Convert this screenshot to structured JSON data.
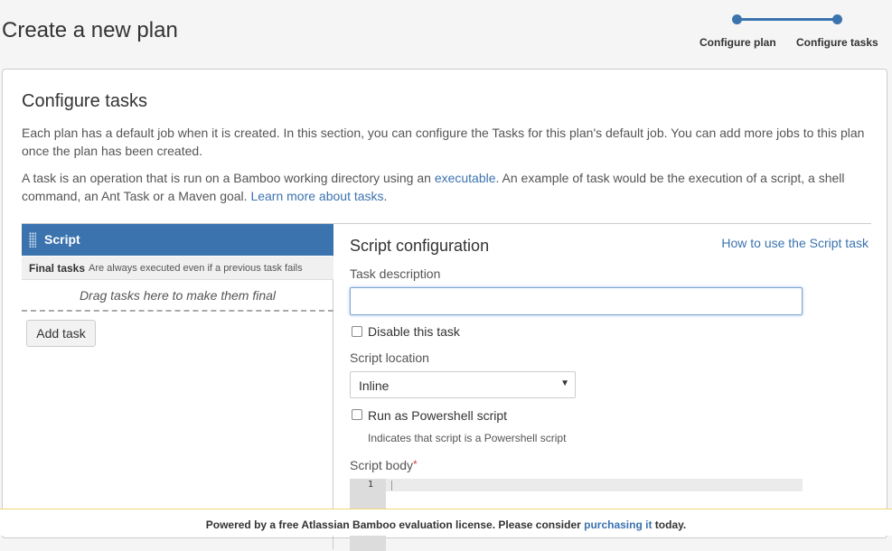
{
  "header": {
    "title": "Create a new plan",
    "steps": [
      {
        "label": "Configure plan",
        "completed": true
      },
      {
        "label": "Configure tasks",
        "current": true
      }
    ]
  },
  "panel": {
    "title": "Configure tasks",
    "intro_1": "Each plan has a default job when it is created. In this section, you can configure the Tasks for this plan's default job. You can add more jobs to this plan once the plan has been created.",
    "intro_2_before": "A task is an operation that is run on a Bamboo working directory using an ",
    "intro_2_link1": "executable",
    "intro_2_middle": ". An example of task would be the execution of a script, a shell command, an Ant Task or a Maven goal. ",
    "intro_2_link2": "Learn more about tasks",
    "intro_2_after": "."
  },
  "tasks": {
    "items": [
      {
        "label": "Script",
        "selected": true
      }
    ],
    "final_title": "Final tasks",
    "final_desc": "Are always executed even if a previous task fails",
    "drop_hint": "Drag tasks here to make them final",
    "add_button": "Add task"
  },
  "config": {
    "title": "Script configuration",
    "help_link": "How to use the Script task",
    "desc_label": "Task description",
    "desc_value": "",
    "disable_label": "Disable this task",
    "disable_checked": false,
    "location_label": "Script location",
    "location_value": "Inline",
    "powershell_label": "Run as Powershell script",
    "powershell_checked": false,
    "powershell_hint": "Indicates that script is a Powershell script",
    "body_label": "Script body",
    "required_mark": "*",
    "line_number": "1"
  },
  "footer": {
    "text_before": "Powered by a free Atlassian Bamboo evaluation license. Please consider ",
    "link": "purchasing it",
    "text_after": " today."
  },
  "colors": {
    "accent": "#3b73af",
    "required": "#d04437"
  }
}
